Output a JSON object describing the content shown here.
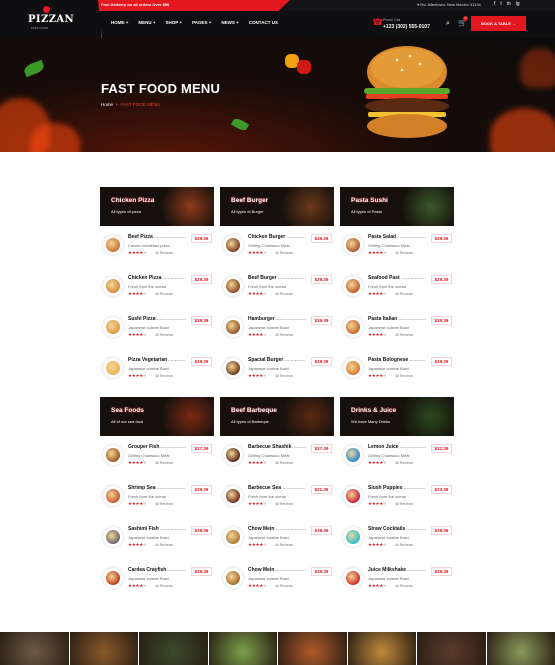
{
  "topbar": {
    "promo": "Free Delivery on all orders Over $50",
    "address": "Rd. Allentown, New Mexico 31134",
    "socials": [
      "f",
      "t",
      "in",
      "ig"
    ]
  },
  "brand": {
    "name": "PIZZAN",
    "tagline": "FAST FOOD"
  },
  "nav": [
    "HOME +",
    "MENU +",
    "SHOP +",
    "PAGES +",
    "NEWS +",
    "CONTACT US"
  ],
  "contact": {
    "label": "Phone Call",
    "phone": "+123 (302) 555-0107"
  },
  "cart_count": "0",
  "cta": "BOOK A TABLE →",
  "hero": {
    "title": "FAST FOOD MENU",
    "breadcrumb": [
      "Home",
      "›",
      "FAST FOOD MENU"
    ]
  },
  "categories": [
    {
      "title": "Chicken Pizza",
      "subtitle": "All types of pizza",
      "photo": "#8e3b1b",
      "items": [
        {
          "name": "Beef Pizza",
          "desc": "Cavoko breakfast pizza",
          "price": "$29.39",
          "reviews": "46 Reviews",
          "color": "#c9762f"
        },
        {
          "name": "Chicken Pizza",
          "desc": "Fresh from the ocean",
          "price": "$29.39",
          "reviews": "46 Reviews",
          "color": "#d68a3a"
        },
        {
          "name": "Sushi Pizza",
          "desc": "Japanese cuisine Bowl",
          "price": "$39.39",
          "reviews": "46 Reviews",
          "color": "#e09a40"
        },
        {
          "name": "Pizza Vegetarian",
          "desc": "Japanese cuisine Bowl",
          "price": "$19.39",
          "reviews": "46 Reviews",
          "color": "#ebb35a"
        }
      ]
    },
    {
      "title": "Beef Burger",
      "subtitle": "All types of Burger",
      "photo": "#6b3a1c",
      "items": [
        {
          "name": "Chicken Burger",
          "desc": "Grilling Charisaco Meat",
          "price": "$26.39",
          "reviews": "46 Reviews",
          "color": "#7a4020"
        },
        {
          "name": "Beef Burger",
          "desc": "Fresh from the ocean",
          "price": "$29.39",
          "reviews": "46 Reviews",
          "color": "#8a4a22"
        },
        {
          "name": "Hamburger",
          "desc": "Japanese cuisine Bowl",
          "price": "$39.39",
          "reviews": "46 Reviews",
          "color": "#93542a"
        },
        {
          "name": "Spacial Burger",
          "desc": "Japanese cuisine Bowl",
          "price": "$19.39",
          "reviews": "46 Reviews",
          "color": "#6e3a1a"
        }
      ]
    },
    {
      "title": "Pasta Sushi",
      "subtitle": "All types of Pasta",
      "photo": "#3a5a2a",
      "items": [
        {
          "name": "Pasta Salad",
          "desc": "Grilling Charisaco Meat",
          "price": "$29.39",
          "reviews": "46 Reviews",
          "color": "#b0552a"
        },
        {
          "name": "Seafood Past",
          "desc": "Fresh from the ocean",
          "price": "$29.39",
          "reviews": "46 Reviews",
          "color": "#c06030"
        },
        {
          "name": "Pasta Italian",
          "desc": "Japanese cuisine Bowl",
          "price": "$35.39",
          "reviews": "46 Reviews",
          "color": "#c8652a"
        },
        {
          "name": "Pasta Bolognese",
          "desc": "Japanese cuisine Bowl",
          "price": "$19.39",
          "reviews": "46 Reviews",
          "color": "#d87a32"
        }
      ]
    },
    {
      "title": "Sea Foods",
      "subtitle": "All of our sea food",
      "photo": "#7a2a14",
      "items": [
        {
          "name": "Grouper Fish",
          "desc": "Grilling Charisaco Meat",
          "price": "$27.39",
          "reviews": "46 Reviews",
          "color": "#a05a20"
        },
        {
          "name": "Shrimp Sea",
          "desc": "Fresh from the ocean",
          "price": "$29.39",
          "reviews": "46 Reviews",
          "color": "#c65a2a"
        },
        {
          "name": "Sashimi Fish",
          "desc": "Japanese cuisine Bowl",
          "price": "$39.39",
          "reviews": "46 Reviews",
          "color": "#6a6a6a"
        },
        {
          "name": "Cardea Crayfish",
          "desc": "Japanese cuisine Bowl",
          "price": "$19.39",
          "reviews": "46 Reviews",
          "color": "#c23a1a"
        }
      ]
    },
    {
      "title": "Beef Barbeque",
      "subtitle": "All types of Barbeque",
      "photo": "#5a2a12",
      "items": [
        {
          "name": "Barbecue Shashik",
          "desc": "Grilling Charisaco Meat",
          "price": "$27.39",
          "reviews": "46 Reviews",
          "color": "#5a2a18"
        },
        {
          "name": "Barbecue Sea",
          "desc": "Fresh from the ocean",
          "price": "$21.39",
          "reviews": "46 Reviews",
          "color": "#6e3020"
        },
        {
          "name": "Chow Mein",
          "desc": "Japanese cuisine Bowl",
          "price": "$39.39",
          "reviews": "46 Reviews",
          "color": "#b07a3a"
        },
        {
          "name": "Chow Mein",
          "desc": "Japanese cuisine Bowl",
          "price": "$19.39",
          "reviews": "46 Reviews",
          "color": "#a86a2a"
        }
      ]
    },
    {
      "title": "Drinks & Juice",
      "subtitle": "We have Many Drinks",
      "photo": "#2a4a1e",
      "items": [
        {
          "name": "Lemon Juice",
          "desc": "Grilling Charisaco Meat",
          "price": "$22.39",
          "reviews": "46 Reviews",
          "color": "#2a8ad0"
        },
        {
          "name": "Slush Puppies",
          "desc": "Fresh from the ocean",
          "price": "$23.39",
          "reviews": "46 Reviews",
          "color": "#c8203a"
        },
        {
          "name": "Straw Cocktails",
          "desc": "Japanese cuisine Bowl",
          "price": "$39.39",
          "reviews": "46 Reviews",
          "color": "#2ac0d0"
        },
        {
          "name": "Juice Milkshake",
          "desc": "Japanese cuisine Bowl",
          "price": "$19.39",
          "reviews": "46 Reviews",
          "color": "#d0302a"
        }
      ]
    }
  ],
  "gallery_colors": [
    "#6b5a44",
    "#8a5a2a",
    "#3a4a2a",
    "#7aa04a",
    "#b05a2a",
    "#c08a3a",
    "#5a3a2a",
    "#8a9a5a"
  ]
}
